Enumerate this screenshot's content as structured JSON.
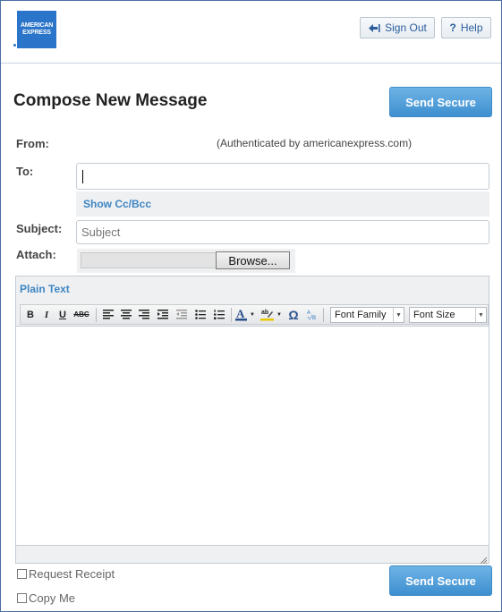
{
  "header": {
    "logo_text": "AMERICAN EXPRESS",
    "sign_out_label": "Sign Out",
    "help_label": "Help",
    "help_prefix": "?"
  },
  "compose": {
    "title": "Compose New Message",
    "send_label": "Send Secure",
    "from_label": "From:",
    "from_note": "(Authenticated by americanexpress.com)",
    "to_label": "To:",
    "to_value": "",
    "show_cc_label": "Show Cc/Bcc",
    "subject_label": "Subject:",
    "subject_placeholder": "Subject",
    "attach_label": "Attach:",
    "browse_label": "Browse..."
  },
  "editor": {
    "plain_text_label": "Plain Text",
    "bold": "B",
    "italic": "I",
    "underline": "U",
    "strike": "ABC",
    "font_family": "Font Family",
    "font_size": "Font Size",
    "omega": "Ω"
  },
  "footer": {
    "request_receipt_label": "Request Receipt",
    "copy_me_label": "Copy Me",
    "send_label": "Send Secure"
  },
  "colors": {
    "accent": "#3d8fcf",
    "link": "#3f86c3",
    "brand": "#2a74c9"
  }
}
